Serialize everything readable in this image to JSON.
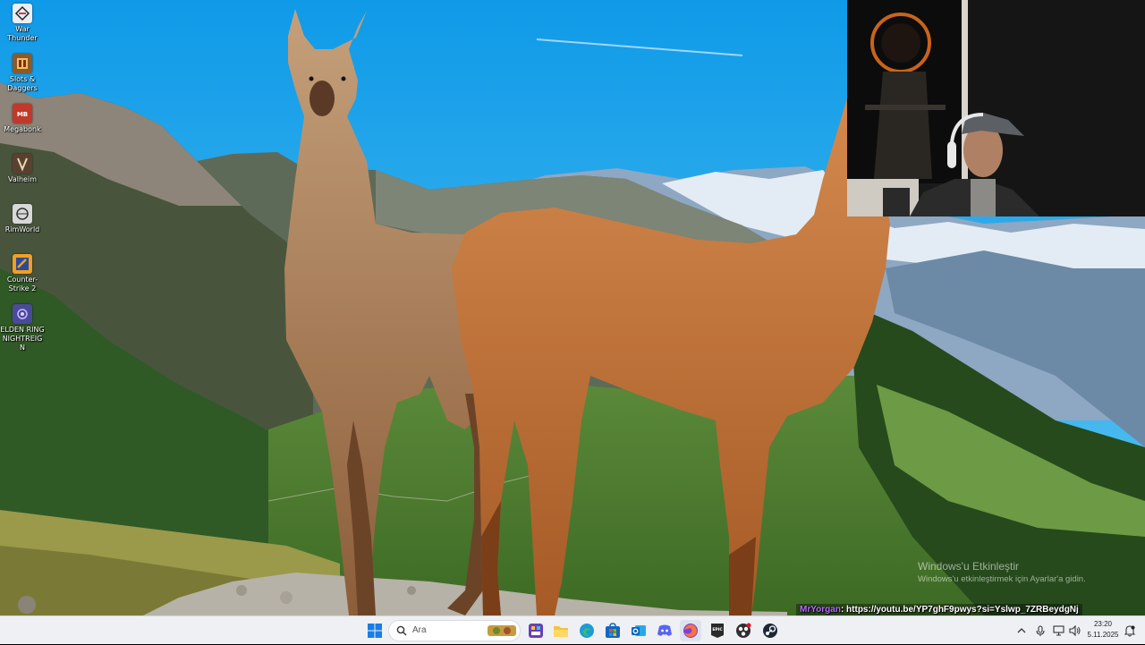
{
  "desktop": {
    "icons": [
      {
        "label": "War Thunder",
        "icon": "war-thunder-icon",
        "color": "#e9eef5"
      },
      {
        "label": "Slots & Daggers",
        "icon": "slots-daggers-icon",
        "color": "#8a5a2a"
      },
      {
        "label": "Megabonk",
        "icon": "megabonk-icon",
        "color": "#c0392b"
      },
      {
        "label": "Valheim",
        "icon": "valheim-icon",
        "color": "#5a4030"
      },
      {
        "label": "RimWorld",
        "icon": "rimworld-icon",
        "color": "#d8d8d8"
      },
      {
        "label": "Counter-Strike 2",
        "icon": "counter-strike-2-icon",
        "color": "#f0a020"
      },
      {
        "label": "ELDEN RING NIGHTREIGN",
        "icon": "elden-ring-nightreign-icon",
        "color": "#4a4a9a"
      }
    ]
  },
  "overlay": {
    "chat_user": "MrYorgan",
    "chat_message": ": https://youtu.be/YP7ghF9pwys?si=Yslwp_7ZRBeydgNj"
  },
  "watermark": {
    "title": "Windows'u Etkinleştir",
    "subtitle": "Windows'u etkinleştirmek için Ayarlar'a gidin."
  },
  "taskbar": {
    "search_placeholder": "Ara",
    "pinned": [
      {
        "name": "windows-start-icon"
      },
      {
        "name": "widgets-icon"
      },
      {
        "name": "file-explorer-icon"
      },
      {
        "name": "edge-icon"
      },
      {
        "name": "microsoft-store-icon"
      },
      {
        "name": "outlook-icon"
      },
      {
        "name": "discord-icon"
      },
      {
        "name": "firefox-icon"
      },
      {
        "name": "epic-games-icon"
      },
      {
        "name": "obs-icon"
      },
      {
        "name": "steam-icon"
      }
    ],
    "clock": {
      "time": "23:20",
      "date": "5.11.2025"
    }
  },
  "colors": {
    "sky": "#1aa6ea",
    "taskbar_bg": "#eef0f4",
    "chat_user": "#b46bff"
  }
}
